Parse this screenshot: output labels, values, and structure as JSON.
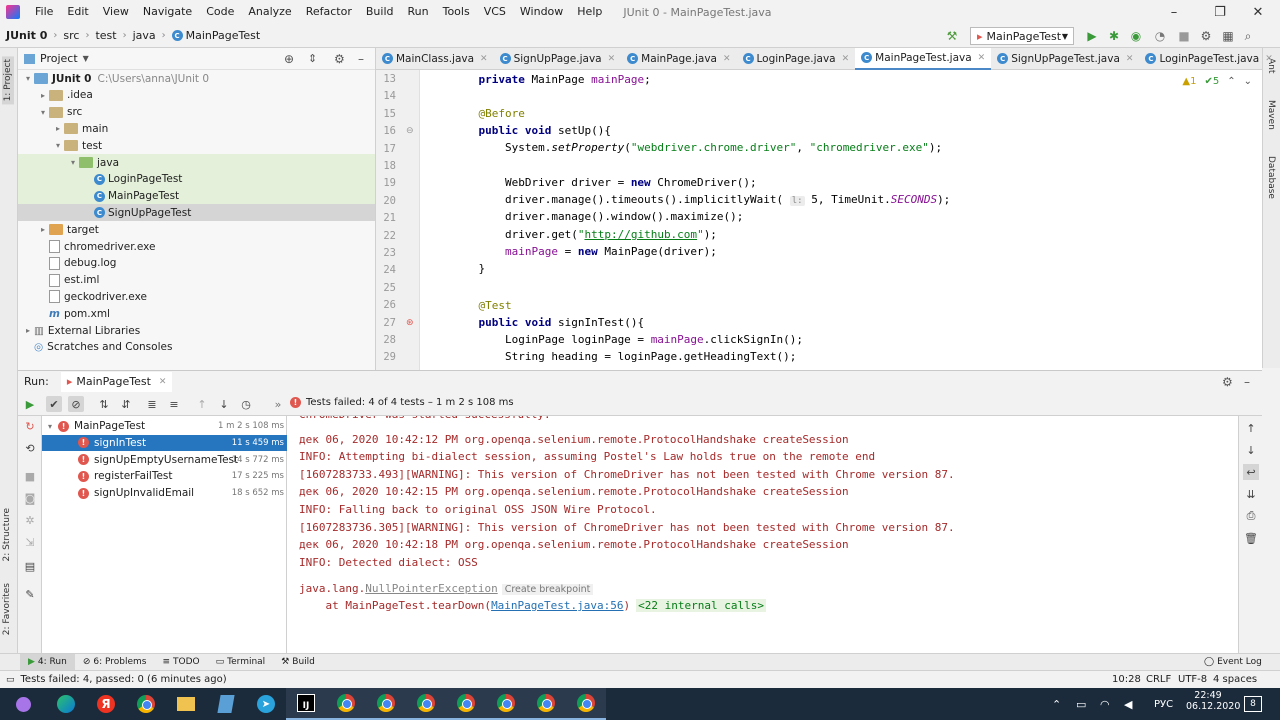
{
  "menu": {
    "items": [
      "File",
      "Edit",
      "View",
      "Navigate",
      "Code",
      "Analyze",
      "Refactor",
      "Build",
      "Run",
      "Tools",
      "VCS",
      "Window",
      "Help"
    ],
    "window_title": "JUnit 0 - MainPageTest.java",
    "minimize": "–",
    "restore": "❐",
    "close": "✕"
  },
  "nav": {
    "crumbs": [
      "JUnit 0",
      "src",
      "test",
      "java",
      "MainPageTest"
    ],
    "run_config": "MainPageTest"
  },
  "stripes": {
    "project": "1: Project",
    "structure": "2: Structure",
    "favorites": "2: Favorites",
    "ant": "Ant",
    "maven": "Maven",
    "database": "Database"
  },
  "project": {
    "header": "Project",
    "tree": [
      {
        "label": "JUnit 0",
        "extra": "C:\\Users\\anna\\JUnit 0",
        "indent": 0,
        "arrow": "▾",
        "icon": "folder-blue",
        "bold": true
      },
      {
        "label": ".idea",
        "indent": 1,
        "arrow": "▸",
        "icon": "folder"
      },
      {
        "label": "src",
        "indent": 1,
        "arrow": "▾",
        "icon": "folder"
      },
      {
        "label": "main",
        "indent": 2,
        "arrow": "▸",
        "icon": "folder"
      },
      {
        "label": "test",
        "indent": 2,
        "arrow": "▾",
        "icon": "folder"
      },
      {
        "label": "java",
        "indent": 3,
        "arrow": "▾",
        "icon": "folder-green",
        "hl": true
      },
      {
        "label": "LoginPageTest",
        "indent": 4,
        "arrow": "",
        "icon": "class",
        "hl": true
      },
      {
        "label": "MainPageTest",
        "indent": 4,
        "arrow": "",
        "icon": "class",
        "hl": true
      },
      {
        "label": "SignUpPageTest",
        "indent": 4,
        "arrow": "",
        "icon": "class",
        "sel": true
      },
      {
        "label": "target",
        "indent": 1,
        "arrow": "▸",
        "icon": "folder-orange"
      },
      {
        "label": "chromedriver.exe",
        "indent": 1,
        "arrow": "",
        "icon": "file"
      },
      {
        "label": "debug.log",
        "indent": 1,
        "arrow": "",
        "icon": "file"
      },
      {
        "label": "est.iml",
        "indent": 1,
        "arrow": "",
        "icon": "file"
      },
      {
        "label": "geckodriver.exe",
        "indent": 1,
        "arrow": "",
        "icon": "file"
      },
      {
        "label": "pom.xml",
        "indent": 1,
        "arrow": "",
        "icon": "maven"
      },
      {
        "label": "External Libraries",
        "indent": 0,
        "arrow": "▸",
        "icon": "lib"
      },
      {
        "label": "Scratches and Consoles",
        "indent": 0,
        "arrow": "",
        "icon": "scratch"
      }
    ]
  },
  "editor": {
    "tabs": [
      {
        "label": "MainClass.java",
        "active": false
      },
      {
        "label": "SignUpPage.java",
        "active": false
      },
      {
        "label": "MainPage.java",
        "active": false
      },
      {
        "label": "LoginPage.java",
        "active": false
      },
      {
        "label": "MainPageTest.java",
        "active": true
      },
      {
        "label": "SignUpPageTest.java",
        "active": false
      },
      {
        "label": "LoginPageTest.java",
        "active": false
      }
    ],
    "inspections": {
      "warnings": "▲1",
      "ok": "✔5"
    },
    "line_numbers": [
      "13",
      "14",
      "15",
      "16",
      "17",
      "18",
      "19",
      "20",
      "21",
      "22",
      "23",
      "24",
      "25",
      "26",
      "27",
      "28",
      "29"
    ]
  },
  "run": {
    "label": "Run:",
    "config_tab": "MainPageTest",
    "status": "Tests failed: 4 of 4 tests – 1 m 2 s 108 ms",
    "tests": [
      {
        "name": "MainPageTest",
        "time": "1 m 2 s 108 ms",
        "root": true
      },
      {
        "name": "signInTest",
        "time": "11 s 459 ms",
        "sel": true
      },
      {
        "name": "signUpEmptyUsernameTest",
        "time": "14 s 772 ms"
      },
      {
        "name": "registerFailTest",
        "time": "17 s 225 ms"
      },
      {
        "name": "signUpInvalidEmail",
        "time": "18 s 652 ms"
      }
    ],
    "console": [
      "ChromeDriver was started successfully.",
      "дек 06, 2020 10:42:12 PM org.openqa.selenium.remote.ProtocolHandshake createSession",
      "INFO: Attempting bi-dialect session, assuming Postel's Law holds true on the remote end",
      "[1607283733.493][WARNING]: This version of ChromeDriver has not been tested with Chrome version 87.",
      "дек 06, 2020 10:42:15 PM org.openqa.selenium.remote.ProtocolHandshake createSession",
      "INFO: Falling back to original OSS JSON Wire Protocol.",
      "[1607283736.305][WARNING]: This version of ChromeDriver has not been tested with Chrome version 87.",
      "дек 06, 2020 10:42:18 PM org.openqa.selenium.remote.ProtocolHandshake createSession",
      "INFO: Detected dialect: OSS"
    ],
    "exception": "java.lang.NullPointerException",
    "breakpoint": "Create breakpoint",
    "at_prefix": "    at MainPageTest.tearDown(",
    "at_link": "MainPageTest.java:56",
    "at_suffix": ")",
    "internal": "<22 internal calls>"
  },
  "bottom_tabs": [
    "4: Run",
    "6: Problems",
    "TODO",
    "Terminal",
    "Build"
  ],
  "event_log": "Event Log",
  "status": {
    "message": "Tests failed: 4, passed: 0 (6 minutes ago)",
    "position": "10:28",
    "line_sep": "CRLF",
    "encoding": "UTF-8",
    "indent": "4 spaces"
  },
  "taskbar": {
    "lang": "РУС",
    "time": "22:49",
    "date": "06.12.2020",
    "notif_count": "8"
  }
}
